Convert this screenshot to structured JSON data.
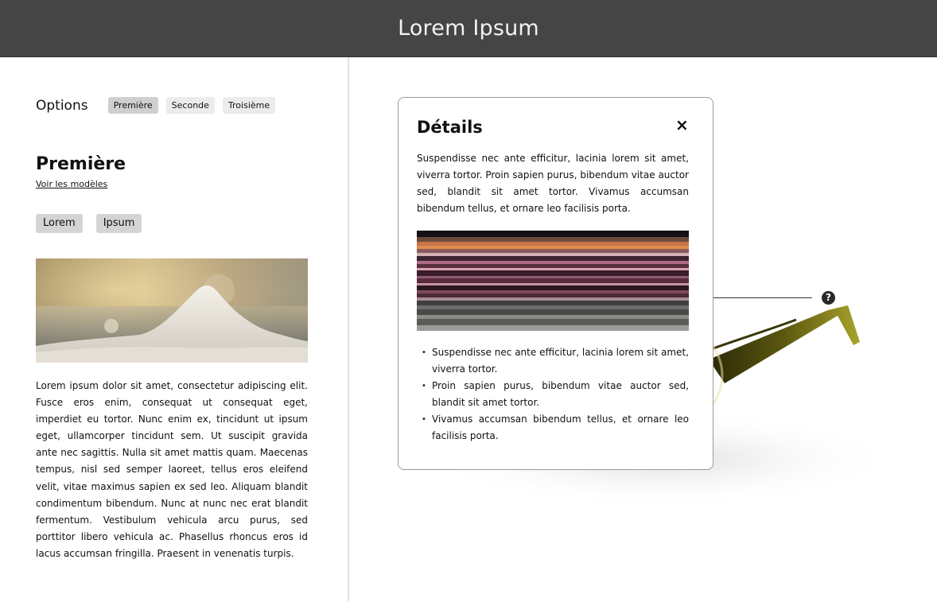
{
  "header": {
    "title": "Lorem Ipsum"
  },
  "options": {
    "label": "Options",
    "chips": [
      "Première",
      "Seconde",
      "Troisième"
    ]
  },
  "section": {
    "title": "Première",
    "link": "Voir les modèles",
    "buttons": [
      "Lorem",
      "Ipsum"
    ],
    "body": "Lorem ipsum dolor sit amet, consectetur adipiscing elit. Fusce eros enim, consequat ut consequat eget, imperdiet eu tortor. Nunc enim ex, tincidunt ut ipsum eget, ullamcorper tincidunt sem. Ut suscipit gravida ante nec sagittis. Nulla sit amet mattis quam. Maecenas tempus, nisl sed semper laoreet, tellus eros eleifend velit, vitae maximus sapien ex sed leo. Aliquam blandit condimentum bibendum. Nunc at nunc nec erat blandit fermentum. Vestibulum vehicula arcu purus, sed porttitor libero vehicula ac. Phasellus rhoncus eros id lacus accumsan fringilla. Praesent in venenatis turpis."
  },
  "modal": {
    "title": "Détails",
    "close_icon": "×",
    "text": "Suspendisse nec ante efficitur, lacinia lorem sit amet, viverra tortor. Proin sapien purus, bibendum vitae auctor sed, blandit sit amet tortor. Vivamus accumsan bibendum tellus, et ornare leo facilisis porta.",
    "bullets": [
      "Suspendisse nec ante efficitur, lacinia lorem sit amet, viverra tortor.",
      "Proin sapien purus, bibendum vitae auctor sed, blandit sit amet tortor.",
      "Vivamus accumsan bibendum tellus, et ornare leo facilisis porta."
    ]
  },
  "hotspot": {
    "icon": "?"
  },
  "colors": {
    "header_bg": "#454545",
    "chip_active": "#cfcfcf",
    "chip": "#ececec",
    "button": "#d4d4d4",
    "frame": "#6e6a12"
  }
}
